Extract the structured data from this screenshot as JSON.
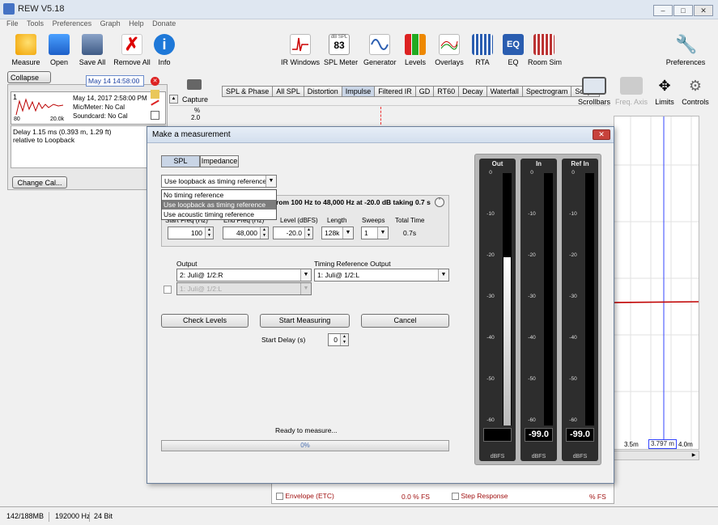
{
  "window": {
    "title": "REW V5.18"
  },
  "menu": [
    "File",
    "Tools",
    "Preferences",
    "Graph",
    "Help",
    "Donate"
  ],
  "toolbar_left": [
    {
      "label": "Measure",
      "icon": "measure-icon"
    },
    {
      "label": "Open",
      "icon": "folder-icon"
    },
    {
      "label": "Save All",
      "icon": "save-icon"
    },
    {
      "label": "Remove All",
      "icon": "remove-icon"
    },
    {
      "label": "Info",
      "icon": "info-icon"
    }
  ],
  "toolbar_center": [
    {
      "label": "IR Windows",
      "icon": "ir-windows-icon"
    },
    {
      "label": "SPL Meter",
      "icon": "spl-meter-icon",
      "value": "83",
      "unit": "dB SPL"
    },
    {
      "label": "Generator",
      "icon": "generator-icon"
    },
    {
      "label": "Levels",
      "icon": "levels-icon"
    },
    {
      "label": "Overlays",
      "icon": "overlays-icon"
    },
    {
      "label": "RTA",
      "icon": "rta-icon"
    },
    {
      "label": "EQ",
      "icon": "eq-icon"
    },
    {
      "label": "Room Sim",
      "icon": "room-sim-icon"
    }
  ],
  "preferences_label": "Preferences",
  "measurement_panel": {
    "collapse_label": "Collapse",
    "name_value": "May 14 14:58:00",
    "index": "1",
    "date": "May 14, 2017 2:58:00 PM",
    "mic": "Mic/Meter: No Cal",
    "soundcard": "Soundcard: No Cal",
    "axis_left": "80",
    "axis_right": "20.0k",
    "notes_line1": "Delay 1.15 ms (0.393 m, 1.29 ft)",
    "notes_line2": "relative to Loopback",
    "change_cal_label": "Change Cal..."
  },
  "capture_label": "Capture",
  "zoom": {
    "unit": "%",
    "value": "2.0"
  },
  "graph_tabs": [
    "SPL & Phase",
    "All SPL",
    "Distortion",
    "Impulse",
    "Filtered IR",
    "GD",
    "RT60",
    "Decay",
    "Waterfall",
    "Spectrogram",
    "Scope"
  ],
  "selected_tab": "Impulse",
  "right_tools": [
    {
      "label": "Scrollbars",
      "icon": "scrollbars-icon"
    },
    {
      "label": "Freq. Axis",
      "icon": "freq-axis-icon"
    },
    {
      "label": "Limits",
      "icon": "limits-icon"
    },
    {
      "label": "Controls",
      "icon": "gear-icon"
    }
  ],
  "plot": {
    "x_label_a": "3.5m",
    "x_label_cursor": "3.797 m",
    "x_label_b": "4.0m",
    "trace_color": "#c00000"
  },
  "dialog": {
    "title": "Make a measurement",
    "mode_spl": "SPL",
    "mode_impedance": "Impedance",
    "timing_ref_selected": "Use loopback as timing reference",
    "timing_options": [
      "No timing reference",
      "Use loopback as timing reference",
      "Use acoustic timing reference"
    ],
    "sweep_summary": "rom 100 Hz to 48,000 Hz at -20.0 dB taking 0.7 s",
    "headers": {
      "start": "Start Freq (Hz)",
      "end": "End Freq (Hz)",
      "level": "Level (dBFS)",
      "length": "Length",
      "sweeps": "Sweeps",
      "total": "Total Time"
    },
    "values": {
      "start": "100",
      "end": "48,000",
      "level": "-20.0",
      "length": "128k",
      "sweeps": "1",
      "total": "0.7s"
    },
    "output_label": "Output",
    "output_value": "2: Juli@ 1/2:R",
    "timing_output_label": "Timing Reference Output",
    "timing_output_value": "1: Juli@ 1/2:L",
    "disabled_output": "1: Juli@ 1/2:L",
    "check_levels": "Check Levels",
    "start_measuring": "Start Measuring",
    "cancel": "Cancel",
    "start_delay_label": "Start Delay (s)",
    "start_delay_value": "0",
    "status": "Ready to measure...",
    "progress": "0%",
    "meters": [
      {
        "label": "Out",
        "unit": "dBFS",
        "readout": "",
        "level_fraction": 0.67
      },
      {
        "label": "In",
        "unit": "dBFS",
        "readout": "-99.0",
        "level_fraction": 0
      },
      {
        "label": "Ref In",
        "unit": "dBFS",
        "readout": "-99.0",
        "level_fraction": 0
      }
    ],
    "scale": [
      "0",
      "-10",
      "-20",
      "-30",
      "-40",
      "-50",
      "-60"
    ]
  },
  "bottom_panel": {
    "row1_label": "Envelope (ETC)",
    "row1_value": "0.0 % FS",
    "row2_label": "Step Response",
    "row2_value": "% FS"
  },
  "status": {
    "memory": "142/188MB",
    "rate": "192000 Hz",
    "bits": "24 Bit"
  }
}
